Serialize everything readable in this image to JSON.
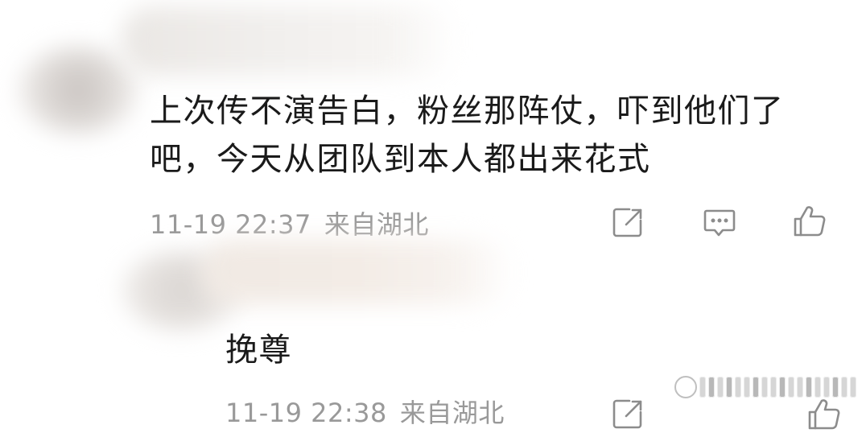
{
  "comment": {
    "text": "上次传不演告白，粉丝那阵仗，吓到他们了吧，今天从团队到本人都出来花式",
    "time": "11-19 22:37",
    "location": "来自湖北"
  },
  "reply": {
    "text": "挽尊",
    "time": "11-19 22:38",
    "location": "来自湖北"
  },
  "icons": {
    "edit": "edit-square-icon",
    "comment": "comment-bubble-icon",
    "like": "thumbs-up-icon",
    "watermark": "watermark-logo-icon"
  },
  "colors": {
    "text": "#1a1a1a",
    "meta": "#999999",
    "icon": "#8c8c8c",
    "background": "#ffffff"
  }
}
